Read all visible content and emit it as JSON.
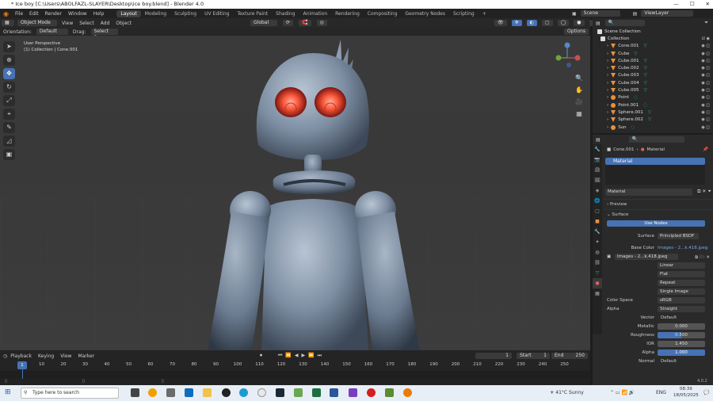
{
  "window": {
    "title": "* Ice boy [C:\\Users\\ABOLFAZL-SLAYER\\Desktop\\ice boy.blend] - Blender 4.0",
    "min": "—",
    "max": "☐",
    "close": "✕"
  },
  "menu": [
    "File",
    "Edit",
    "Render",
    "Window",
    "Help"
  ],
  "workspaces": [
    "Layout",
    "Modeling",
    "Sculpting",
    "UV Editing",
    "Texture Paint",
    "Shading",
    "Animation",
    "Rendering",
    "Compositing",
    "Geometry Nodes",
    "Scripting",
    "+"
  ],
  "scene": {
    "scene_label": "Scene",
    "viewlayer_label": "ViewLayer"
  },
  "header": {
    "mode": "Object Mode",
    "view": "View",
    "select": "Select",
    "add": "Add",
    "object": "Object",
    "transform": "Global"
  },
  "header2": {
    "orientation_label": "Orientation:",
    "orientation": "Default",
    "drag_label": "Drag:",
    "drag": "Select Box",
    "options": "Options"
  },
  "viewport": {
    "line1": "User Perspective",
    "line2": "(1) Collection | Cone.001"
  },
  "outliner": {
    "root": "Scene Collection",
    "collection": "Collection",
    "items": [
      {
        "name": "Cone.001",
        "type": "mesh"
      },
      {
        "name": "Cube",
        "type": "mesh"
      },
      {
        "name": "Cube.001",
        "type": "mesh"
      },
      {
        "name": "Cube.002",
        "type": "mesh"
      },
      {
        "name": "Cube.003",
        "type": "mesh"
      },
      {
        "name": "Cube.004",
        "type": "mesh"
      },
      {
        "name": "Cube.005",
        "type": "mesh"
      },
      {
        "name": "Point",
        "type": "light"
      },
      {
        "name": "Point.001",
        "type": "light"
      },
      {
        "name": "Sphere.001",
        "type": "mesh"
      },
      {
        "name": "Sphere.002",
        "type": "mesh"
      },
      {
        "name": "Sun",
        "type": "light"
      }
    ]
  },
  "properties": {
    "breadcrumb_object": "Cone.001",
    "breadcrumb_material": "Material",
    "slot": "Material",
    "material_name": "Material",
    "preview": "Preview",
    "surface": "Surface",
    "use_nodes": "Use Nodes",
    "surface_label": "Surface",
    "surface_value": "Principled BSDF",
    "base_color_label": "Base Color",
    "base_color_value": "Images - 2...k.418.jpeg",
    "image_name": "Images - 2...k.418.jpeg",
    "interp": "Linear",
    "proj": "Flat",
    "ext": "Repeat",
    "src": "Single Image",
    "colorspace_label": "Color Space",
    "colorspace": "sRGB",
    "alpha_label": "Alpha",
    "alpha_mode": "Straight",
    "vector_label": "Vector",
    "vector": "Default",
    "metallic_label": "Metallic",
    "metallic": "0.000",
    "roughness_label": "Roughness",
    "roughness": "0.500",
    "ior_label": "IOR",
    "ior": "1.450",
    "alpha2_label": "Alpha",
    "alpha2": "1.000",
    "normal_label": "Normal",
    "normal": "Default"
  },
  "timeline": {
    "playback": "Playback",
    "keying": "Keying",
    "view": "View",
    "marker": "Marker",
    "current": "1",
    "start_label": "Start",
    "start": "1",
    "end_label": "End",
    "end": "250",
    "ticks": [
      "10",
      "20",
      "30",
      "40",
      "50",
      "60",
      "70",
      "80",
      "90",
      "100",
      "110",
      "120",
      "130",
      "140",
      "150",
      "160",
      "170",
      "180",
      "190",
      "200",
      "210",
      "220",
      "230",
      "240",
      "250"
    ],
    "frame_marker": "1"
  },
  "statusbar": {
    "version": "4.0.2"
  },
  "taskbar": {
    "search": "Type here to search",
    "weather": "41°C  Sunny",
    "lang": "ENG",
    "time": "08:39",
    "date": "18/05/2025"
  },
  "colors": {
    "accent": "#4772b3",
    "mesh_icon": "#e8913b",
    "data_icon": "#3fb77b"
  }
}
